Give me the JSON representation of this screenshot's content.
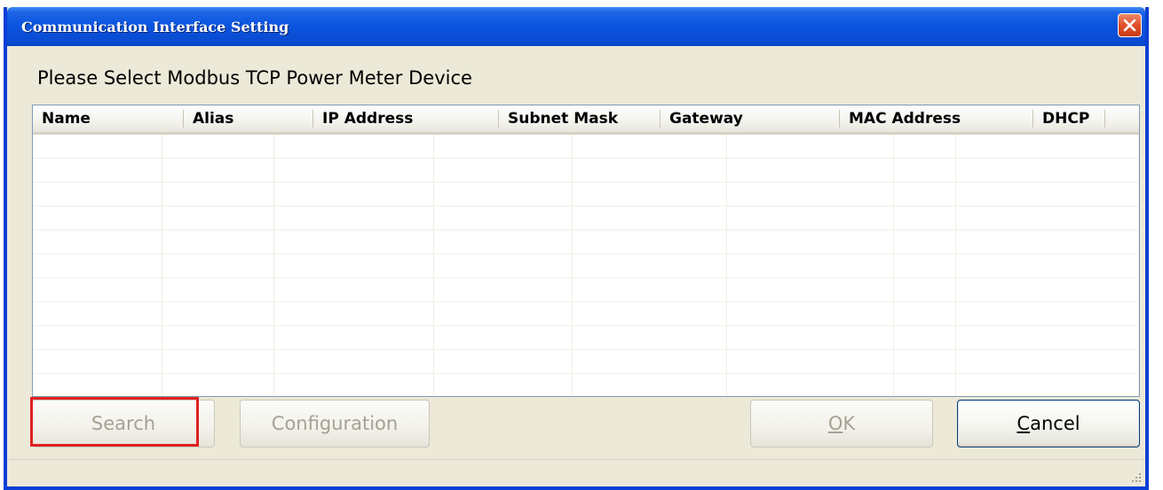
{
  "window": {
    "title": "Communication Interface Setting"
  },
  "prompt": "Please Select Modbus TCP Power Meter Device",
  "table": {
    "columns": [
      "Name",
      "Alias",
      "IP Address",
      "Subnet Mask",
      "Gateway",
      "MAC Address",
      "DHCP"
    ],
    "rows": []
  },
  "buttons": {
    "search": "Search",
    "configuration": "Configuration",
    "ok_mnemonic": "O",
    "ok_rest": "K",
    "cancel_mnemonic": "C",
    "cancel_rest": "ancel"
  },
  "icons": {
    "close": "close-icon",
    "grip": "resize-grip-icon"
  },
  "colors": {
    "titlebar": "#0a4fd8",
    "close": "#e0502a",
    "highlight": "#e02020"
  }
}
